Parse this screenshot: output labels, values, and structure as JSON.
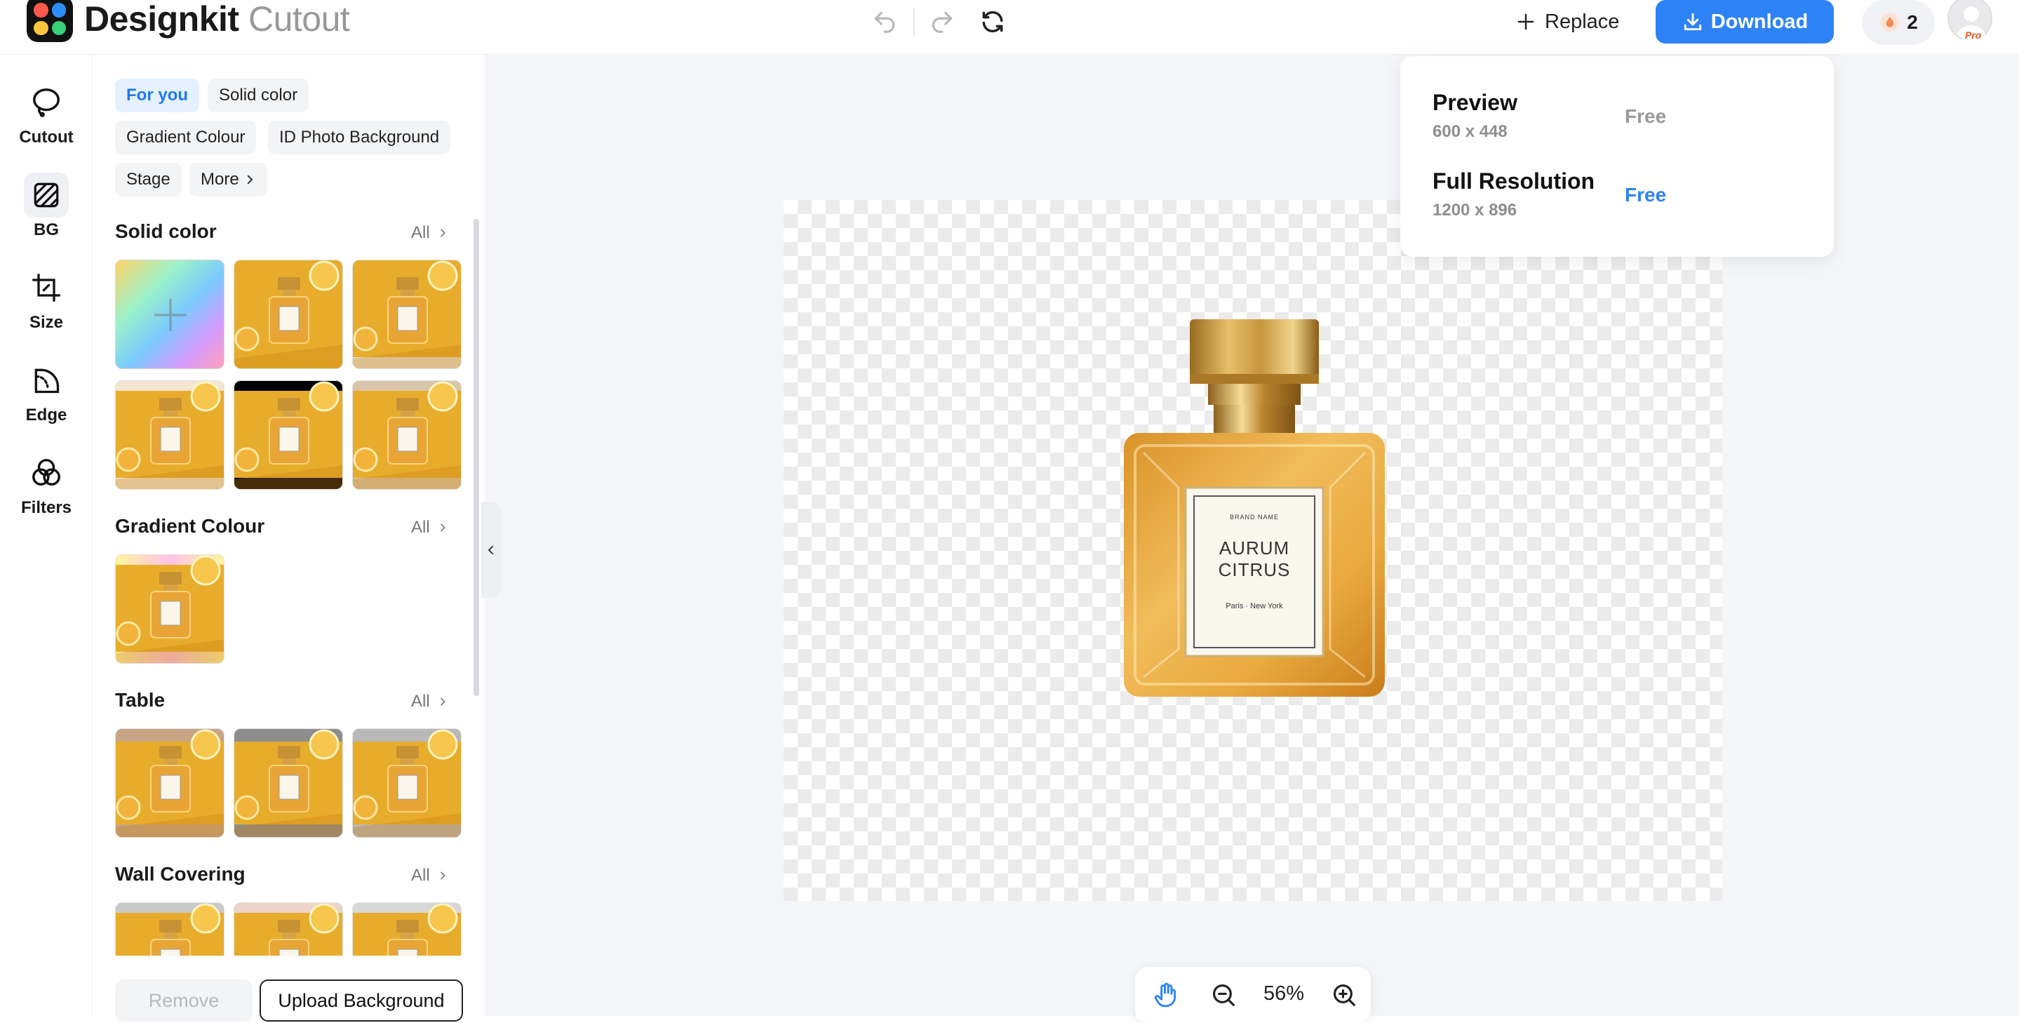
{
  "app": {
    "name": "Designkit",
    "module": "Cutout"
  },
  "toolbar": {
    "undo_icon": "undo-icon",
    "redo_icon": "redo-icon",
    "reset_icon": "refresh-icon",
    "replace_label": "Replace",
    "download_label": "Download",
    "credits": "2",
    "avatar_badge": "Pro"
  },
  "rail": {
    "items": [
      {
        "label": "Cutout",
        "icon": "lasso-icon"
      },
      {
        "label": "BG",
        "icon": "hatched-square-icon",
        "active": true
      },
      {
        "label": "Size",
        "icon": "crop-icon"
      },
      {
        "label": "Edge",
        "icon": "edge-icon"
      },
      {
        "label": "Filters",
        "icon": "filters-icon"
      }
    ]
  },
  "panel": {
    "chips": [
      "For you",
      "Solid color",
      "Gradient Colour",
      "ID Photo Background",
      "Stage",
      "More"
    ],
    "active_chip": "For you",
    "sections": [
      {
        "title": "Solid color",
        "all": "All"
      },
      {
        "title": "Gradient Colour",
        "all": "All"
      },
      {
        "title": "Table",
        "all": "All"
      },
      {
        "title": "Wall Covering",
        "all": "All"
      }
    ],
    "remove_label": "Remove",
    "upload_label": "Upload Background"
  },
  "download_popover": {
    "options": [
      {
        "title": "Preview",
        "dims": "600 x 448",
        "price": "Free",
        "price_color": "#9a9a9a"
      },
      {
        "title": "Full Resolution",
        "dims": "1200 x 896",
        "price": "Free",
        "price_color": "#2d83f5"
      }
    ]
  },
  "product_label": {
    "brand": "BRAND NAME",
    "line1": "AURUM",
    "line2": "CITRUS",
    "city": "Paris · New York"
  },
  "zoom": {
    "value": "56%"
  },
  "colors": {
    "accent": "#2d83f5",
    "perfume_gold": "#e8a83a",
    "thumb_yellow": "#e8ac2c"
  }
}
